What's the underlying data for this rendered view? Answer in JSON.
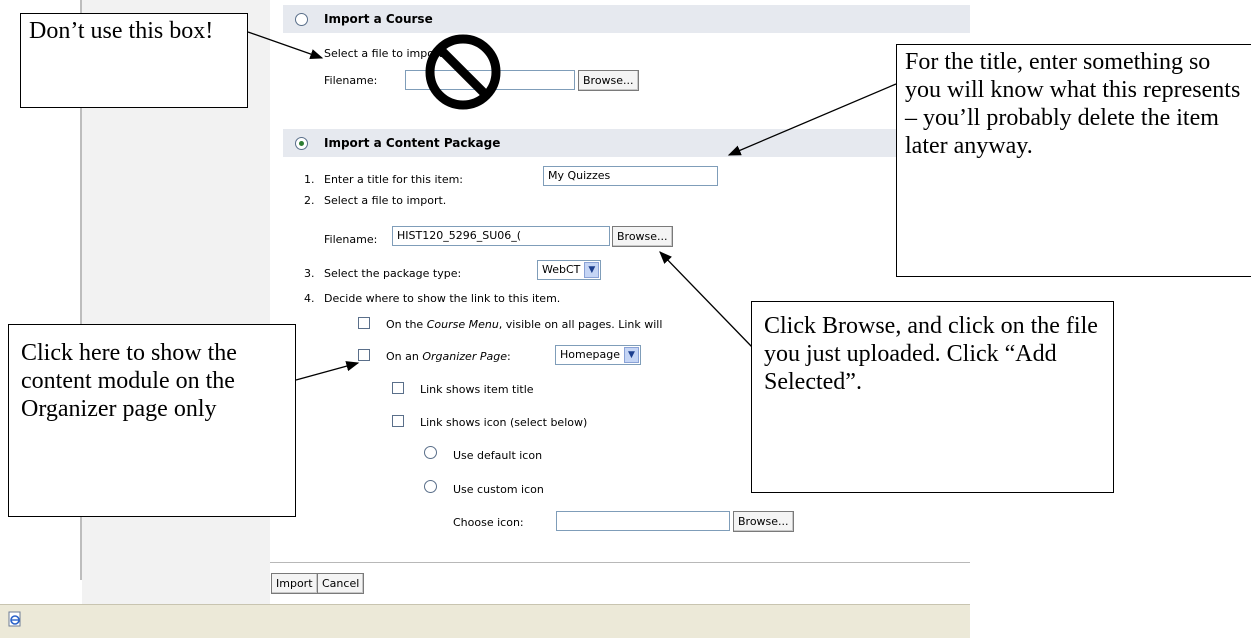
{
  "import_course": {
    "title": "Import a Course",
    "select_text": "Select a file to import.",
    "filename_label": "Filename:",
    "filename_value": "",
    "browse_label": "Browse..."
  },
  "import_package": {
    "title": "Import a Content Package",
    "step1_num": "1.",
    "step1_label": "Enter a title for this item:",
    "title_value": "My Quizzes",
    "step2_num": "2.",
    "step2_label": "Select a file to import.",
    "filename_label": "Filename:",
    "filename_value": "HIST120_5296_SU06_(",
    "browse_label": "Browse...",
    "step3_num": "3.",
    "step3_label": "Select the package type:",
    "package_type": "WebCT",
    "step4_num": "4.",
    "step4_label": "Decide where to show the link to this item.",
    "course_menu_prefix": "On the ",
    "course_menu_em": "Course Menu",
    "course_menu_suffix": ", visible on all pages. Link will",
    "organizer_prefix": "On an ",
    "organizer_em": "Organizer Page",
    "organizer_suffix": ":",
    "organizer_value": "Homepage",
    "link_title": "Link shows item title",
    "link_icon": "Link shows icon (select below)",
    "default_icon": "Use default icon",
    "custom_icon": "Use custom icon",
    "choose_icon_label": "Choose icon:",
    "choose_icon_value": "",
    "choose_browse": "Browse..."
  },
  "footer": {
    "import_label": "Import",
    "cancel_label": "Cancel"
  },
  "callouts": {
    "dont_use": "Don’t use this box!",
    "title_hint": "For the title, enter something so you will know what this represents – you’ll probably delete the item later anyway.",
    "browse_hint": "Click Browse, and click on the file you just uploaded. Click “Add Selected”.",
    "organizer_hint": "Click here to show the content module on the Organizer page only"
  },
  "icons": {
    "status": "ie-page-icon",
    "no_sign": "prohibited-icon",
    "dropdown": "chevron-down-icon"
  },
  "colors": {
    "section_header": "#e6e9ef",
    "left_pane": "#f2f2f2",
    "status_bar": "#ece9d8",
    "radio_selected": "#2e7d32"
  }
}
